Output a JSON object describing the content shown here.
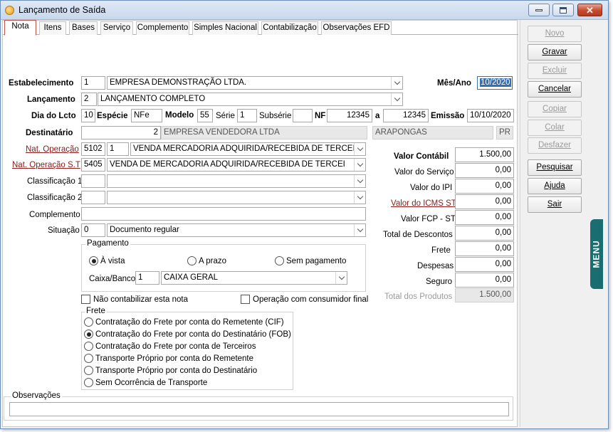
{
  "window": {
    "title": "Lançamento de Saída"
  },
  "tabs": [
    "Nota",
    "Itens",
    "Bases",
    "Serviço",
    "Complemento",
    "Simples Nacional",
    "Contabilização",
    "Observações EFD"
  ],
  "side_buttons": [
    "Novo",
    "Gravar",
    "Excluir",
    "Cancelar",
    "Copiar",
    "Colar",
    "Desfazer",
    "Pesquisar",
    "Ajuda",
    "Sair"
  ],
  "menu_tab": "MENU",
  "form": {
    "estabelecimento": {
      "label": "Estabelecimento",
      "code": "1",
      "name": "EMPRESA DEMONSTRAÇÃO LTDA."
    },
    "mes_ano": {
      "label": "Mês/Ano",
      "value": "10/2020"
    },
    "lancamento": {
      "label": "Lançamento",
      "code": "2",
      "name": "LANÇAMENTO COMPLETO"
    },
    "dia_lcto": {
      "label": "Dia do Lcto",
      "value": "10"
    },
    "especie": {
      "label": "Espécie",
      "value": "NFe"
    },
    "modelo": {
      "label": "Modelo",
      "value": "55"
    },
    "serie": {
      "label": "Série",
      "value": "1"
    },
    "subserie": {
      "label": "Subsérie",
      "value": ""
    },
    "nf": {
      "label": "NF",
      "start": "12345",
      "a_label": "a",
      "end": "12345"
    },
    "emissao": {
      "label": "Emissão",
      "value": "10/10/2020"
    },
    "destinatario": {
      "label": "Destinatário",
      "code": "2",
      "name": "EMPRESA VENDEDORA LTDA",
      "city": "ARAPONGAS",
      "uf": "PR"
    },
    "nat_operacao": {
      "label": "Nat. Operação",
      "cfop": "5102",
      "seq": "1",
      "desc": "VENDA MERCADORIA ADQUIRIDA/RECEBIDA DE TERCEIROS"
    },
    "nat_operacao_st": {
      "label": "Nat. Operação S.T",
      "cfop": "5405",
      "desc": "VENDA DE MERCADORIA ADQUIRIDA/RECEBIDA DE TERCEI"
    },
    "classificacao1": {
      "label": "Classificação 1",
      "code": "",
      "desc": ""
    },
    "classificacao2": {
      "label": "Classificação 2",
      "code": "",
      "desc": ""
    },
    "complemento": {
      "label": "Complemento",
      "value": ""
    },
    "situacao": {
      "label": "Situação",
      "code": "0",
      "desc": "Documento regular"
    },
    "pagamento": {
      "title": "Pagamento",
      "options": [
        "À vista",
        "A prazo",
        "Sem pagamento"
      ],
      "selected": "À vista",
      "caixa_label": "Caixa/Banco",
      "caixa_code": "1",
      "caixa_name": "CAIXA GERAL"
    },
    "nao_contabilizar": "Não contabilizar esta nota",
    "consumidor_final": "Operação com consumidor final",
    "frete": {
      "title": "Frete",
      "options": [
        "Contratação do Frete por conta do Remetente (CIF)",
        "Contratação do Frete por conta do Destinatário (FOB)",
        "Contratação do Frete por conta de Terceiros",
        "Transporte Próprio por conta do Remetente",
        "Transporte Próprio por conta do Destinatário",
        "Sem Ocorrência de Transporte"
      ],
      "selected_index": 1
    },
    "observacoes": {
      "label": "Observações",
      "value": ""
    }
  },
  "valores": {
    "valor_contabil": {
      "label": "Valor Contábil",
      "value": "1.500,00"
    },
    "valor_servico": {
      "label": "Valor do Serviço",
      "value": "0,00"
    },
    "valor_ipi": {
      "label": "Valor do IPI",
      "value": "0,00"
    },
    "valor_icms_st": {
      "label": "Valor do ICMS ST",
      "value": "0,00"
    },
    "valor_fcp_st": {
      "label": "Valor FCP - ST",
      "value": "0,00"
    },
    "total_descontos": {
      "label": "Total de Descontos",
      "value": "0,00"
    },
    "frete": {
      "label": "Frete",
      "value": "0,00"
    },
    "despesas": {
      "label": "Despesas",
      "value": "0,00"
    },
    "seguro": {
      "label": "Seguro",
      "value": "0,00"
    },
    "total_produtos": {
      "label": "Total dos Produtos",
      "value": "1.500,00"
    }
  }
}
